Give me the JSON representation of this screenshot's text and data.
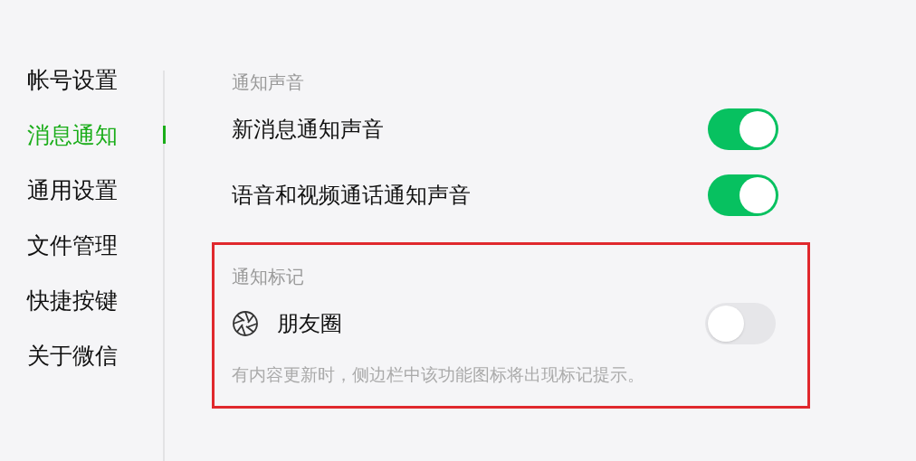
{
  "sidebar": {
    "items": [
      {
        "label": "帐号设置",
        "selected": false
      },
      {
        "label": "消息通知",
        "selected": true
      },
      {
        "label": "通用设置",
        "selected": false
      },
      {
        "label": "文件管理",
        "selected": false
      },
      {
        "label": "快捷按键",
        "selected": false
      },
      {
        "label": "关于微信",
        "selected": false
      }
    ]
  },
  "sections": [
    {
      "title": "通知声音",
      "highlighted": false,
      "rows": [
        {
          "kind": "plain",
          "label": "新消息通知声音",
          "on": true
        },
        {
          "kind": "plain",
          "label": "语音和视频通话通知声音",
          "on": true
        }
      ]
    },
    {
      "title": "通知标记",
      "highlighted": true,
      "rows": [
        {
          "kind": "icon",
          "label": "朋友圈",
          "on": false
        }
      ],
      "note": "有内容更新时，侧边栏中该功能图标将出现标记提示。"
    }
  ]
}
